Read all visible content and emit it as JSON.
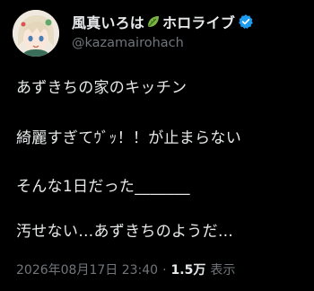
{
  "author": {
    "display_name_part1": "風真いろは",
    "display_name_part2": "ホロライブ",
    "handle": "@kazamairohach",
    "name_emoji_icon": "leaf-emoji-icon",
    "verified_icon": "verified-badge-icon",
    "verified_color": "#1d9bf0"
  },
  "post": {
    "lines": [
      "あずきちの家のキッチン",
      "綺麗すぎてｳﾞｯ！！が止まらない",
      "そんな1日だった_______",
      "汚せない…あずきちのようだ…"
    ]
  },
  "meta": {
    "timestamp": "2026年08月17日 23:40",
    "separator": "·",
    "views_count": "1.5万",
    "views_label": "表示"
  },
  "colors": {
    "background": "#000000",
    "primary_text": "#e7e9ea",
    "secondary_text": "#71767b"
  }
}
